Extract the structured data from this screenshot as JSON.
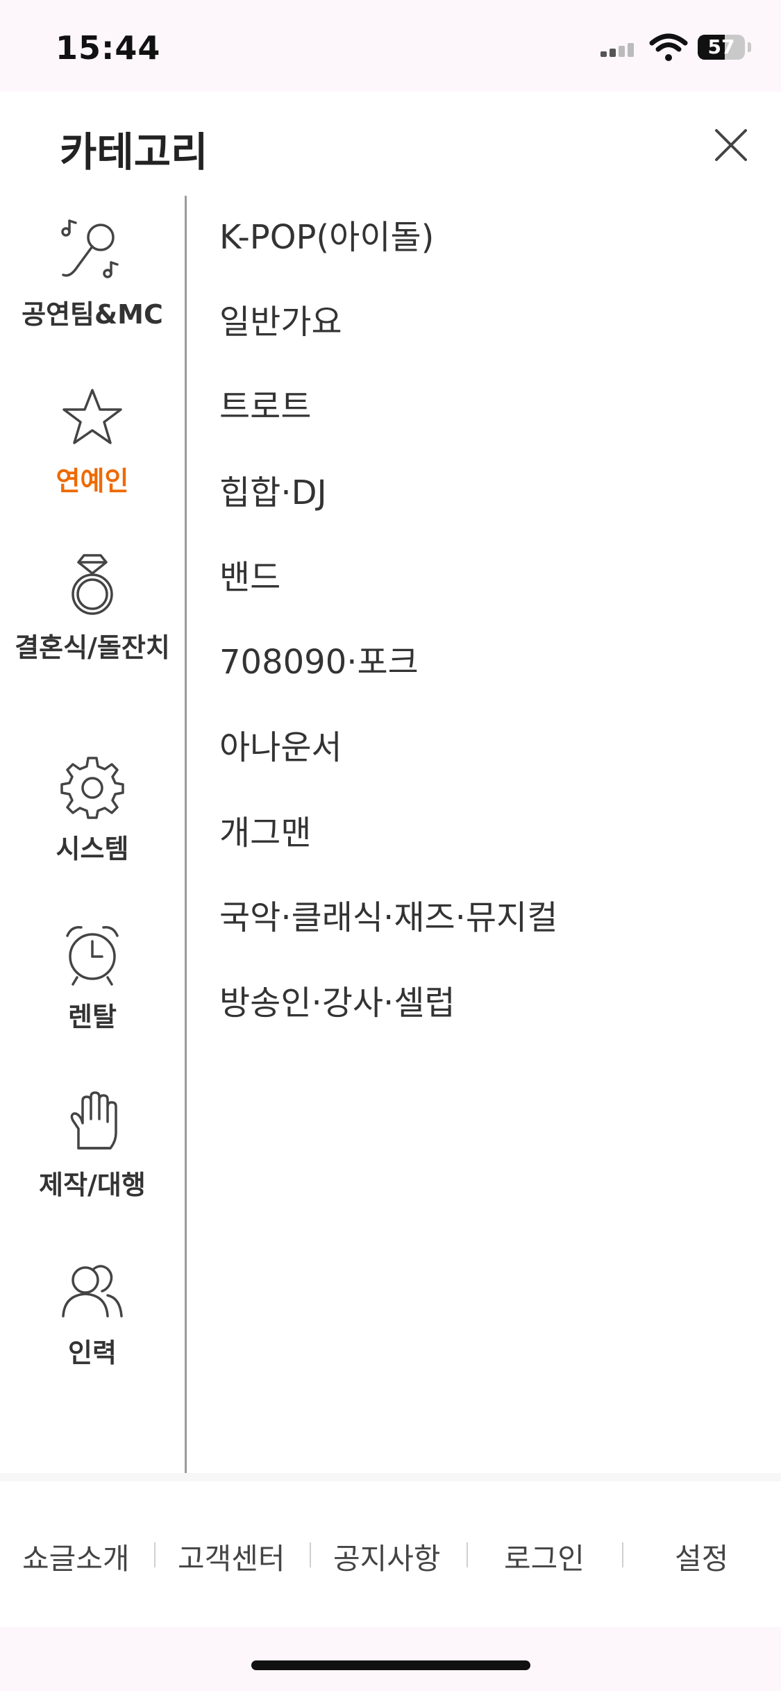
{
  "status": {
    "time": "15:44",
    "battery": "57",
    "battery_percent": 57
  },
  "header": {
    "title": "카테고리",
    "close_icon": "close-icon"
  },
  "categories": [
    {
      "label": "공연팀&MC",
      "icon": "microphone-icon",
      "active": false
    },
    {
      "label": "연예인",
      "icon": "star-icon",
      "active": true
    },
    {
      "label": "결혼식/돌잔치",
      "icon": "ring-icon",
      "active": false
    },
    {
      "label": "시스템",
      "icon": "gear-icon",
      "active": false
    },
    {
      "label": "렌탈",
      "icon": "alarm-clock-icon",
      "active": false
    },
    {
      "label": "제작/대행",
      "icon": "glove-icon",
      "active": false
    },
    {
      "label": "인력",
      "icon": "people-icon",
      "active": false
    }
  ],
  "subcategories": [
    "K-POP(아이돌)",
    "일반가요",
    "트로트",
    "힙합·DJ",
    "밴드",
    "708090·포크",
    "아나운서",
    "개그맨",
    "국악·클래식·재즈·뮤지컬",
    "방송인·강사·셀럽"
  ],
  "footer": {
    "links": [
      "쇼글소개",
      "고객센터",
      "공지사항",
      "로그인",
      "설정"
    ]
  },
  "colors": {
    "accent": "#ee6a00",
    "text": "#333333",
    "background": "#fdf6fb"
  }
}
